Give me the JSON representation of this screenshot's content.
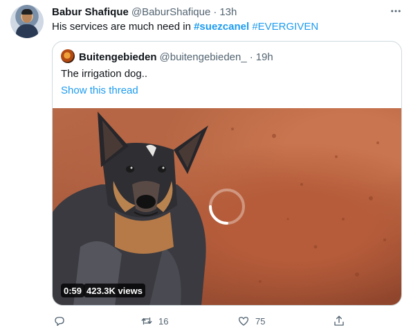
{
  "tweet": {
    "author_name": "Babur Shafique",
    "author_handle": "@BaburShafique",
    "separator": "·",
    "time": "13h",
    "text_prefix": "His services are much need in ",
    "hashtag_1": "#suezcanel",
    "hashtag_2": "#EVERGIVEN",
    "more_icon": "more-horizontal-icon"
  },
  "quoted": {
    "author_name": "Buitengebieden",
    "author_handle": "@buitengebieden_",
    "separator": "·",
    "time": "19h",
    "text": "The irrigation dog..",
    "show_thread": "Show this thread",
    "video": {
      "duration": "0:59",
      "views": "423.3K views",
      "state": "loading"
    }
  },
  "actions": {
    "reply_icon": "reply-icon",
    "retweet_icon": "retweet-icon",
    "retweet_count": "16",
    "like_icon": "like-icon",
    "like_count": "75",
    "share_icon": "share-icon"
  },
  "colors": {
    "accent": "#1d9bf0",
    "secondary_text": "#536471",
    "border": "#cfd9de"
  }
}
